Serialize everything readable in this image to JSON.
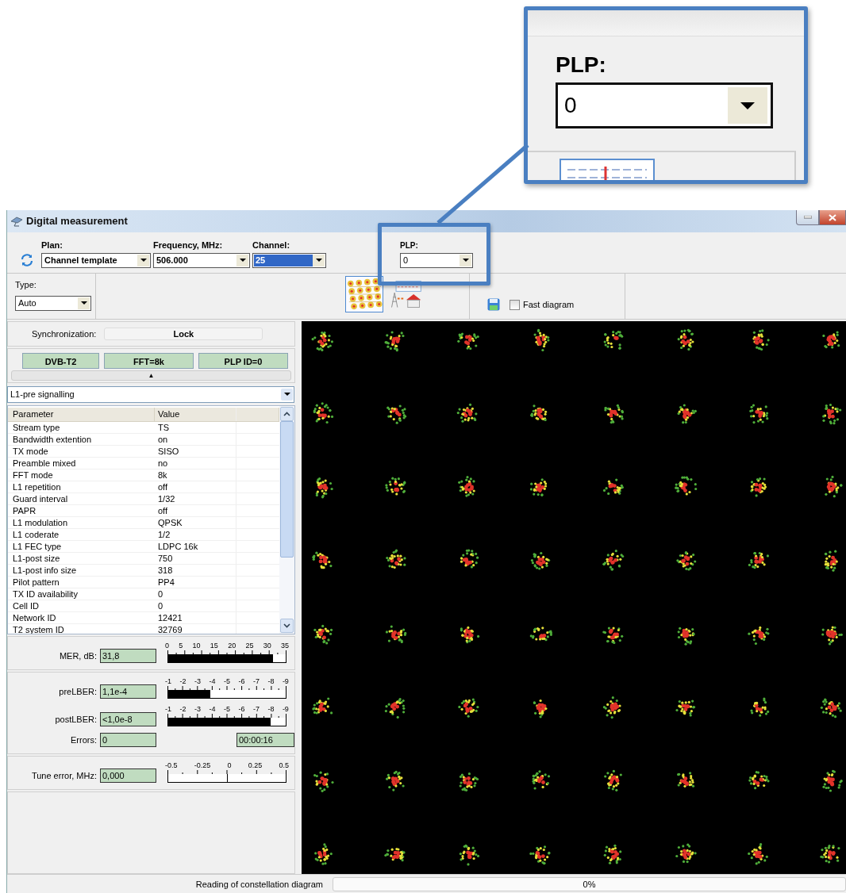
{
  "callout": {
    "label": "PLP:",
    "value": "0"
  },
  "window": {
    "title": "Digital measurement"
  },
  "toolbar": {
    "fields": [
      {
        "label": "Plan:",
        "value": "Channel template",
        "highlighted": false
      },
      {
        "label": "Frequency,  MHz:",
        "value": "506.000",
        "highlighted": false
      },
      {
        "label": "Channel:",
        "value": "25",
        "highlighted": true
      }
    ],
    "plp": {
      "label": "PLP:",
      "value": "0"
    },
    "type": {
      "label": "Type:",
      "value": "Auto"
    },
    "views": [
      {
        "kind": "constellation",
        "selected": true
      },
      {
        "kind": "transmitter",
        "selected": false
      }
    ],
    "fast_diagram": {
      "label": "Fast diagram",
      "checked": false
    }
  },
  "sync": {
    "label": "Synchronization:",
    "value": "Lock"
  },
  "badges": [
    "DVB-T2",
    "FFT=8k",
    "PLP ID=0"
  ],
  "collapse": "▲",
  "section_select": {
    "value": "L1-pre signalling"
  },
  "table": {
    "columns": [
      "Parameter",
      "Value"
    ],
    "rows": [
      [
        "Stream type",
        "TS"
      ],
      [
        "Bandwidth extention",
        "on"
      ],
      [
        "TX mode",
        "SISO"
      ],
      [
        "Preamble mixed",
        "no"
      ],
      [
        "FFT mode",
        "8k"
      ],
      [
        "L1 repetition",
        "off"
      ],
      [
        "Guard interval",
        "1/32"
      ],
      [
        "PAPR",
        "off"
      ],
      [
        "L1 modulation",
        "QPSK"
      ],
      [
        "L1 coderate",
        "1/2"
      ],
      [
        "L1 FEC type",
        "LDPC 16k"
      ],
      [
        "L1-post size",
        "750"
      ],
      [
        "L1-post info size",
        "318"
      ],
      [
        "Pilot pattern",
        "PP4"
      ],
      [
        "TX ID availability",
        "0"
      ],
      [
        "Cell ID",
        "0"
      ],
      [
        "Network ID",
        "12421"
      ],
      [
        "T2 system ID",
        "32769"
      ]
    ]
  },
  "groups": [
    {
      "meters": [
        {
          "kind": "bar",
          "label": "MER, dB:",
          "value": "31,8",
          "ticks": [
            "0",
            "5",
            "10",
            "15",
            "20",
            "25",
            "30",
            "35"
          ],
          "level": 0.89
        }
      ]
    },
    {
      "meters": [
        {
          "kind": "bar",
          "label": "preLBER:",
          "value": "1,1e-4",
          "ticks": [
            "-1",
            "-2",
            "-3",
            "-4",
            "-5",
            "-6",
            "-7",
            "-8",
            "-9"
          ],
          "level": 0.36
        },
        {
          "kind": "bar",
          "label": "postLBER:",
          "value": "<1,0e-8",
          "ticks": [
            "-1",
            "-2",
            "-3",
            "-4",
            "-5",
            "-6",
            "-7",
            "-8",
            "-9"
          ],
          "level": 0.87
        }
      ],
      "errors": {
        "label": "Errors:",
        "value": "0",
        "time": "00:00:16"
      }
    },
    {
      "meters": [
        {
          "kind": "marker",
          "label": "Tune error, MHz:",
          "value": "0,000",
          "ticks": [
            "-0.5",
            "-0.25",
            "0",
            "0.25",
            "0.5"
          ],
          "level": 0.5
        }
      ]
    }
  ],
  "status_bar": {
    "text": "Reading of constellation diagram",
    "progress": {
      "level": 0,
      "reading": "0%"
    }
  }
}
